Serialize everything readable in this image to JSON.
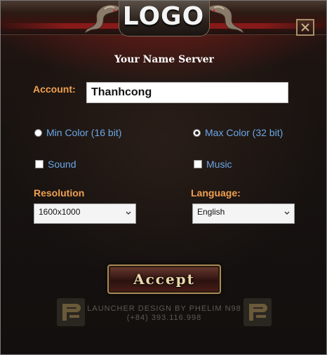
{
  "window": {
    "logo_text": "LOGO",
    "server_name": "Your Name Server"
  },
  "account": {
    "label": "Account:",
    "value": "Thanhcong"
  },
  "color_options": {
    "min_label": "Min Color (16 bit)",
    "min_selected": false,
    "max_label": "Max Color (32 bit)",
    "max_selected": true
  },
  "toggles": {
    "sound_label": "Sound",
    "sound_checked": false,
    "music_label": "Music",
    "music_checked": false
  },
  "resolution": {
    "label": "Resolution",
    "selected": "1600x1000"
  },
  "language": {
    "label": "Language:",
    "selected": "English"
  },
  "accept_label": "Accept",
  "credit": {
    "line1": "LAUNCHER DESIGN BY PHELIM N98",
    "line2": "(+84) 393.116.998"
  },
  "icons": [
    "dragon-left-icon",
    "dragon-right-icon",
    "close-icon",
    "chevron-down-icon",
    "pe-brand-icon"
  ],
  "colors": {
    "accent_orange": "#f0a050",
    "option_blue": "#6aa8e8",
    "button_gold": "#a88a55"
  }
}
